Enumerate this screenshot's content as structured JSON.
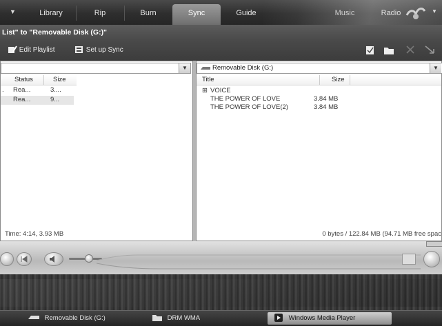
{
  "tabs": [
    {
      "label": "Library"
    },
    {
      "label": "Rip"
    },
    {
      "label": "Burn"
    },
    {
      "label": "Sync",
      "active": true
    },
    {
      "label": "Guide"
    },
    {
      "label": "Music"
    },
    {
      "label": "Radio"
    }
  ],
  "title_strip": "List\" to \"Removable Disk (G:)\"",
  "toolbar": {
    "edit_playlist": "Edit Playlist",
    "setup_sync": "Set up Sync"
  },
  "left_pane": {
    "columns": [
      "Status",
      "Size"
    ],
    "rows": [
      {
        "prefix": ".",
        "status": "Rea...",
        "size": "3...."
      },
      {
        "prefix": "",
        "status": "Rea...",
        "size": "9..."
      }
    ],
    "footer": "Time: 4:14, 3.93 MB"
  },
  "right_pane": {
    "device": "Removable Disk (G:)",
    "columns": [
      "Title",
      "Size"
    ],
    "tree": [
      {
        "expander": "⊞",
        "title": "VOICE",
        "size": ""
      },
      {
        "expander": "",
        "title": "THE POWER OF LOVE",
        "size": "3.84 MB"
      },
      {
        "expander": "",
        "title": "THE POWER OF LOVE(2)",
        "size": "3.84 MB"
      }
    ],
    "footer": "0 bytes / 122.84 MB (94.71 MB free spac"
  },
  "player": {
    "volume_level_fraction": 0.33
  },
  "taskbar": {
    "items": [
      {
        "label": "Removable Disk (G:)",
        "active": false
      },
      {
        "label": "DRM WMA",
        "active": false
      },
      {
        "label": "Windows Media Player",
        "active": true
      }
    ]
  },
  "colors": {
    "tab_bar": "#2e2e2e",
    "active_tab": "#8a8a8a",
    "pane_bg": "#ffffff"
  }
}
